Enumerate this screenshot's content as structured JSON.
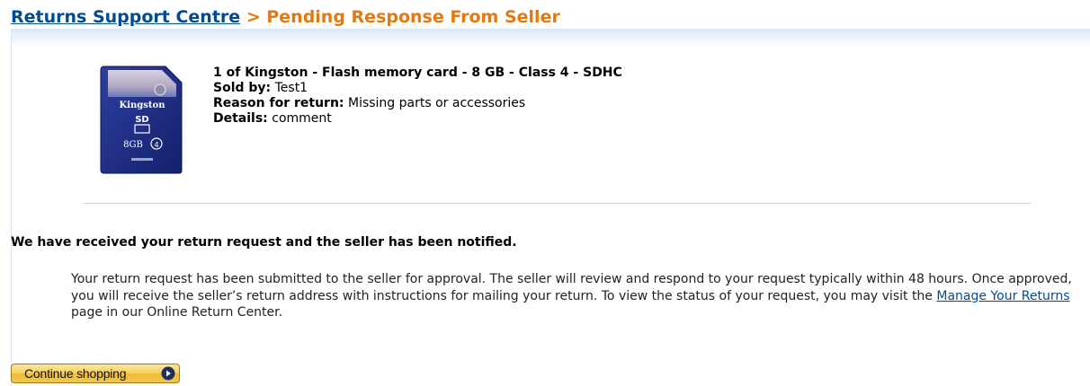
{
  "breadcrumb": {
    "link_label": "Returns Support Centre",
    "separator": ">",
    "current": "Pending Response From Seller"
  },
  "product": {
    "title": "1 of Kingston - Flash memory card - 8 GB - Class 4 - SDHC",
    "sold_by_label": "Sold by:",
    "sold_by_value": "Test1",
    "reason_label": "Reason for return:",
    "reason_value": "Missing parts or accessories",
    "details_label": "Details:",
    "details_value": "comment",
    "image": {
      "brand": "Kingston",
      "capacity": "8GB",
      "class": "4",
      "icon": "sd-card-image"
    }
  },
  "notice": {
    "heading": "We have received your return request and the seller has been notified.",
    "body_before_link": "Your return request has been submitted to the seller for approval. The seller will review and respond to your request typically within 48 hours. Once approved, you will receive the seller’s return address with instructions for mailing your return. To view the status of your request, you may visit the ",
    "link_label": "Manage Your Returns",
    "body_after_link": " page in our Online Return Center."
  },
  "actions": {
    "continue_label": "Continue shopping",
    "continue_icon": "arrow-right-circle-icon"
  },
  "colors": {
    "link": "#004b91",
    "accent_orange": "#e47911",
    "button_gold": "#f2c64b"
  }
}
